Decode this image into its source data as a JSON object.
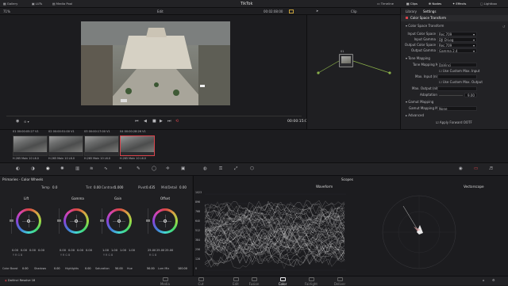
{
  "app": {
    "title": "TikTok",
    "brand": "DaVinci Resolve 18"
  },
  "topbar": {
    "left": [
      "Gallery",
      "LUTs",
      "Media Pool"
    ],
    "right": [
      "Timeline",
      "Clips",
      "Nodes",
      "Effects",
      "Lightbox"
    ]
  },
  "viewerbar": {
    "zoom": "71%",
    "edit": "Edit",
    "timecode": "00:02:08:00",
    "clip": "Clip"
  },
  "viewer": {
    "timecode": "00:00:15:00"
  },
  "node": {
    "label": "01"
  },
  "inspector": {
    "tabs": [
      "Library",
      "Settings"
    ],
    "title": "Color Space Transform",
    "section_cst": "Color Space Transform",
    "rows": [
      {
        "label": "Input Color Space",
        "value": "Rec.709"
      },
      {
        "label": "Input Gamma",
        "value": "DJI D-Log"
      },
      {
        "label": "Output Color Space",
        "value": "Rec.709"
      },
      {
        "label": "Output Gamma",
        "value": "Gamma 2.4"
      }
    ],
    "section_tone": "Tone Mapping",
    "tone_method_label": "Tone Mapping Method",
    "tone_method_value": "DaVinci",
    "max_input_label": "Max. Input (nits)",
    "check1": "Use Custom Max. Input",
    "max_output_label": "Max. Output (nits)",
    "check2": "Use Custom Max. Output",
    "adaptation_label": "Adaptation",
    "adaptation_value": "9.00",
    "section_gamut": "Gamut Mapping",
    "gamut_method_label": "Gamut Mapping Method",
    "gamut_method_value": "None",
    "section_advanced": "Advanced",
    "apply_ootf": "Apply Forward OOTF"
  },
  "clips": [
    {
      "num": "01",
      "tc": "00:00:05:27",
      "track": "V1",
      "codec": "H.265 Main 10 L6.0"
    },
    {
      "num": "02",
      "tc": "00:00:51:00",
      "track": "V1",
      "codec": "H.265 Main 10 L6.0"
    },
    {
      "num": "03",
      "tc": "00:00:17:00",
      "track": "V1",
      "codec": "H.265 Main 10 L6.0"
    },
    {
      "num": "04",
      "tc": "00:00:28:26",
      "track": "V1",
      "codec": "H.265 Main 10 L6.0"
    }
  ],
  "wheels": {
    "panel_title": "Primaries - Color Wheels",
    "temp_label": "Temp",
    "temp_val": "0.0",
    "tint_label": "Tint",
    "tint_val": "0.00",
    "contrast_label": "Contrast",
    "contrast_val": "1.000",
    "pivot_label": "Pivot",
    "pivot_val": "0.435",
    "middet_label": "Mid/Detail",
    "middet_val": "0.00",
    "items": [
      {
        "name": "Lift",
        "vals": [
          "0.00",
          "0.00",
          "0.00",
          "0.00"
        ]
      },
      {
        "name": "Gamma",
        "vals": [
          "0.00",
          "0.00",
          "0.00",
          "0.00"
        ]
      },
      {
        "name": "Gain",
        "vals": [
          "1.00",
          "1.00",
          "1.00",
          "1.00"
        ]
      },
      {
        "name": "Offset",
        "vals": [
          "25.00",
          "25.00",
          "25.00"
        ]
      }
    ],
    "bottom": [
      {
        "label": "Color Boost",
        "val": "0.00"
      },
      {
        "label": "Shadows",
        "val": "0.00"
      },
      {
        "label": "Highlights",
        "val": "0.00"
      },
      {
        "label": "Saturation",
        "val": "50.00"
      },
      {
        "label": "Hue",
        "val": "50.00"
      },
      {
        "label": "Lum Mix",
        "val": "100.00"
      }
    ]
  },
  "scopes": {
    "title": "Scopes",
    "waveform": "Waveform",
    "vectorscope": "Vectorscope",
    "axis": [
      "1023",
      "896",
      "768",
      "640",
      "512",
      "384",
      "256",
      "128",
      "0"
    ]
  },
  "pagebar": {
    "pages": [
      "Media",
      "Cut",
      "Edit",
      "Fusion",
      "Color",
      "Fairlight",
      "Deliver"
    ],
    "active": "Color"
  },
  "colors": {
    "accent_red": "#d9434b",
    "bg": "#1a1a1c"
  }
}
